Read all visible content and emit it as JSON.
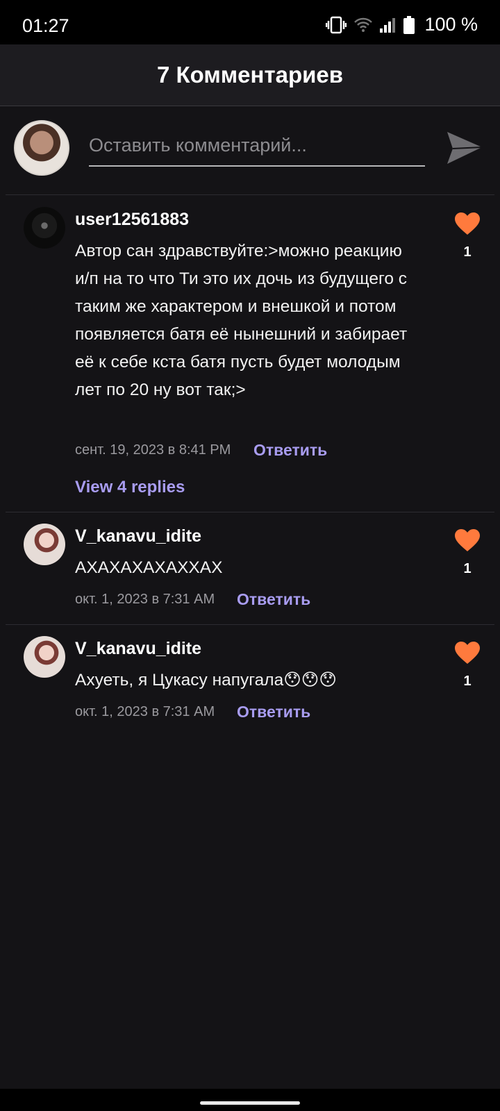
{
  "status_bar": {
    "time": "01:27",
    "battery": "100 %"
  },
  "header": {
    "title": "7 Комментариев"
  },
  "compose": {
    "placeholder": "Оставить комментарий..."
  },
  "comments": [
    {
      "username": "user12561883",
      "text": "Автор сан здравствуйте:>можно реакцию и/п на то что Ти это их дочь из будущего с таким же характером и внешкой и потом появляется батя её нынешний и забирает её к себе кста батя пусть будет молодым лет по 20 ну вот так;>",
      "date": "сент. 19, 2023 в 8:41 PM",
      "reply_label": "Ответить",
      "likes": "1",
      "view_replies": "View 4 replies"
    },
    {
      "username": "V_kanavu_idite",
      "text": "АХАХАХАХАХХАХ",
      "date": "окт. 1, 2023 в 7:31 AM",
      "reply_label": "Ответить",
      "likes": "1"
    },
    {
      "username": "V_kanavu_idite",
      "text": "Ахуеть, я Цукасу напугала😯😯😯",
      "date": "окт. 1, 2023 в 7:31 AM",
      "reply_label": "Ответить",
      "likes": "1"
    }
  ],
  "colors": {
    "accent": "#a89cf0",
    "heart": "#ff7a3d",
    "background": "#141316"
  }
}
